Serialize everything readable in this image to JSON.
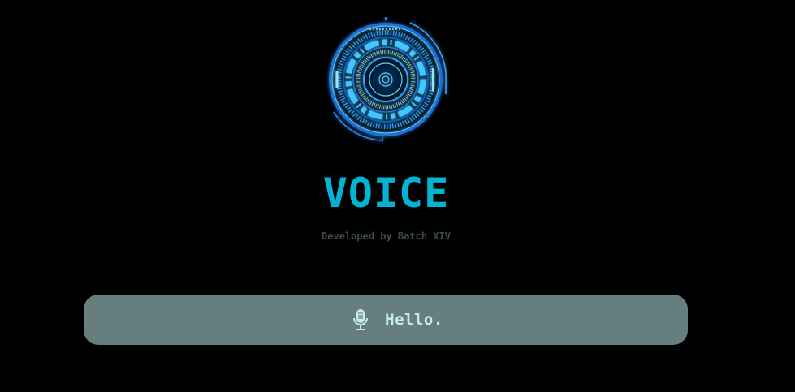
{
  "app": {
    "title": "VOICE",
    "subtitle": "Developed by Batch XIV"
  },
  "logo": {
    "icon": "hud-ring-icon",
    "color": "#1e9be6"
  },
  "voice_bar": {
    "icon": "microphone-icon",
    "text": "Hello.",
    "background": "#667e7e"
  },
  "colors": {
    "background": "#000000",
    "accent": "#00b4d2",
    "subtitle": "#3b4a4e",
    "voice_text": "#c4ece8"
  }
}
